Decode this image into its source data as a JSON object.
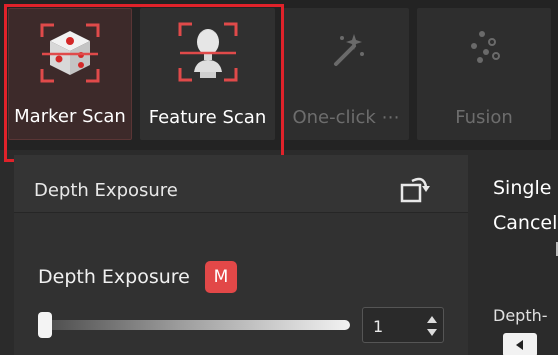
{
  "toolbar": {
    "tools": [
      {
        "label": "Marker Scan",
        "state": "selected",
        "icon": "marker-scan-icon"
      },
      {
        "label": "Feature Scan",
        "state": "normal",
        "icon": "feature-scan-icon"
      },
      {
        "label": "One-click ⋯",
        "state": "disabled",
        "icon": "magic-wand-icon"
      },
      {
        "label": "Fusion",
        "state": "disabled",
        "icon": "fusion-icon"
      }
    ],
    "highlight_color": "#e0222a"
  },
  "panel": {
    "title": "Depth Exposure",
    "field_label": "Depth Exposure",
    "badge": "M",
    "badge_color": "#e24848",
    "slider_fraction": 0.0,
    "spin_value": "1"
  },
  "right": {
    "line1": "Single",
    "line2": "Cancel",
    "depth_label": "Depth-"
  }
}
